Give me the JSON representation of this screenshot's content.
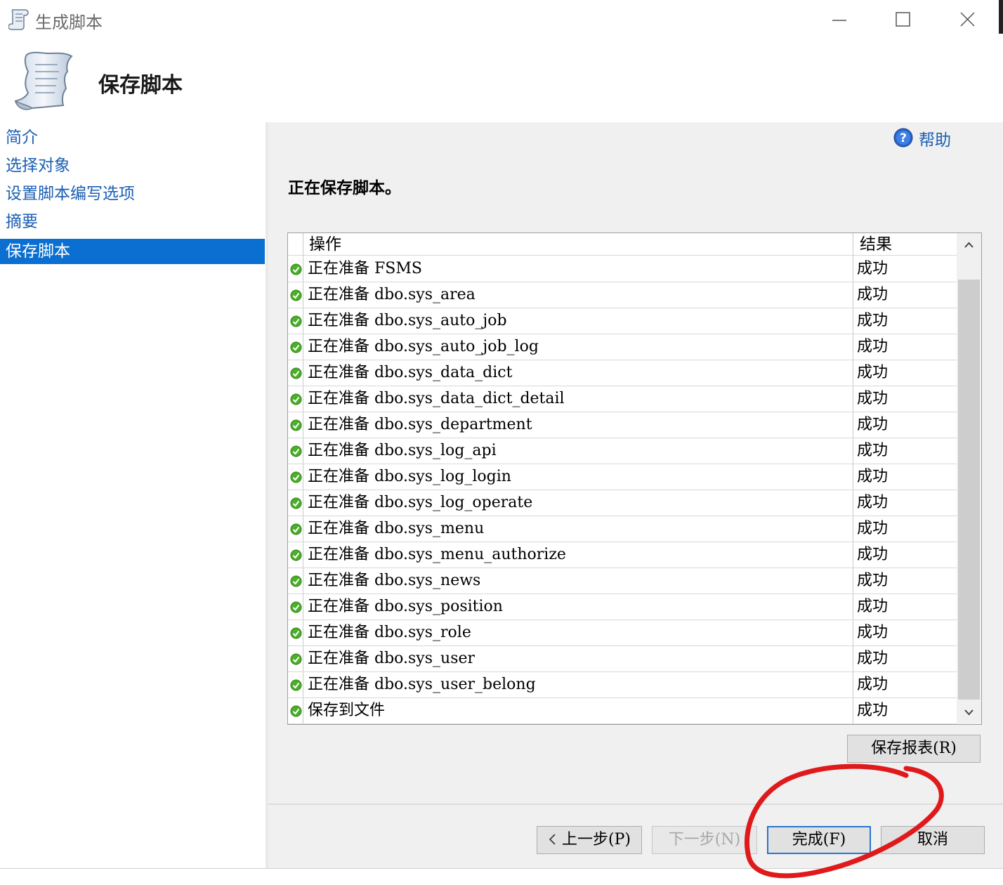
{
  "window": {
    "title": "生成脚本",
    "icon": "script-scroll-icon",
    "controls": [
      "minimize-icon",
      "maximize-icon",
      "close-icon"
    ]
  },
  "header": {
    "heading": "保存脚本",
    "icon": "scroll-icon"
  },
  "sidebar": {
    "items": [
      {
        "label": "简介",
        "active": false
      },
      {
        "label": "选择对象",
        "active": false
      },
      {
        "label": "设置脚本编写选项",
        "active": false
      },
      {
        "label": "摘要",
        "active": false
      },
      {
        "label": "保存脚本",
        "active": true
      }
    ]
  },
  "help": {
    "label": "帮助",
    "icon": "help-icon"
  },
  "status": "正在保存脚本。",
  "grid": {
    "columns": [
      "操作",
      "结果"
    ],
    "rows": [
      {
        "op": "正在准备 FSMS",
        "result": "成功"
      },
      {
        "op": "正在准备 dbo.sys_area",
        "result": "成功"
      },
      {
        "op": "正在准备 dbo.sys_auto_job",
        "result": "成功"
      },
      {
        "op": "正在准备 dbo.sys_auto_job_log",
        "result": "成功"
      },
      {
        "op": "正在准备 dbo.sys_data_dict",
        "result": "成功"
      },
      {
        "op": "正在准备 dbo.sys_data_dict_detail",
        "result": "成功"
      },
      {
        "op": "正在准备 dbo.sys_department",
        "result": "成功"
      },
      {
        "op": "正在准备 dbo.sys_log_api",
        "result": "成功"
      },
      {
        "op": "正在准备 dbo.sys_log_login",
        "result": "成功"
      },
      {
        "op": "正在准备 dbo.sys_log_operate",
        "result": "成功"
      },
      {
        "op": "正在准备 dbo.sys_menu",
        "result": "成功"
      },
      {
        "op": "正在准备 dbo.sys_menu_authorize",
        "result": "成功"
      },
      {
        "op": "正在准备 dbo.sys_news",
        "result": "成功"
      },
      {
        "op": "正在准备 dbo.sys_position",
        "result": "成功"
      },
      {
        "op": "正在准备 dbo.sys_role",
        "result": "成功"
      },
      {
        "op": "正在准备 dbo.sys_user",
        "result": "成功"
      },
      {
        "op": "正在准备 dbo.sys_user_belong",
        "result": "成功"
      },
      {
        "op": "保存到文件",
        "result": "成功"
      }
    ]
  },
  "buttons": {
    "save_report": "保存报表(R)",
    "prev": "上一步(P)",
    "prev_icon": "chevron-left-icon",
    "next": "下一步(N)",
    "finish": "完成(F)",
    "cancel": "取消"
  },
  "colors": {
    "accent": "#0a6fd0",
    "link": "#1a5fb4",
    "success_icon": "#4caf28",
    "annotation_circle": "#e0191b"
  }
}
